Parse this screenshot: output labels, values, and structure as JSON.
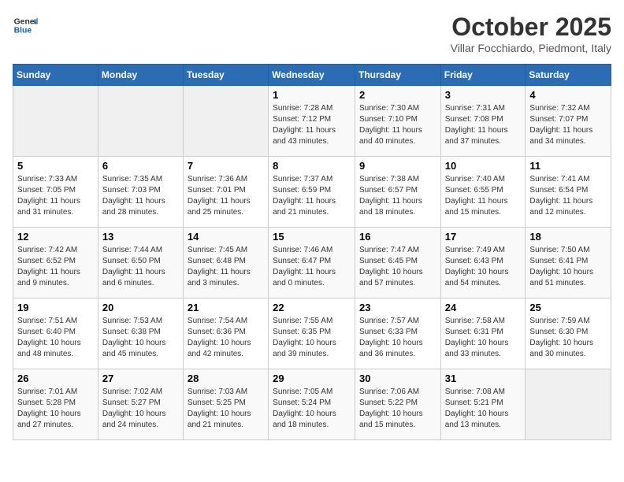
{
  "header": {
    "logo_line1": "General",
    "logo_line2": "Blue",
    "month": "October 2025",
    "location": "Villar Focchiardo, Piedmont, Italy"
  },
  "days_of_week": [
    "Sunday",
    "Monday",
    "Tuesday",
    "Wednesday",
    "Thursday",
    "Friday",
    "Saturday"
  ],
  "weeks": [
    [
      {
        "day": "",
        "content": ""
      },
      {
        "day": "",
        "content": ""
      },
      {
        "day": "",
        "content": ""
      },
      {
        "day": "1",
        "content": "Sunrise: 7:28 AM\nSunset: 7:12 PM\nDaylight: 11 hours and 43 minutes."
      },
      {
        "day": "2",
        "content": "Sunrise: 7:30 AM\nSunset: 7:10 PM\nDaylight: 11 hours and 40 minutes."
      },
      {
        "day": "3",
        "content": "Sunrise: 7:31 AM\nSunset: 7:08 PM\nDaylight: 11 hours and 37 minutes."
      },
      {
        "day": "4",
        "content": "Sunrise: 7:32 AM\nSunset: 7:07 PM\nDaylight: 11 hours and 34 minutes."
      }
    ],
    [
      {
        "day": "5",
        "content": "Sunrise: 7:33 AM\nSunset: 7:05 PM\nDaylight: 11 hours and 31 minutes."
      },
      {
        "day": "6",
        "content": "Sunrise: 7:35 AM\nSunset: 7:03 PM\nDaylight: 11 hours and 28 minutes."
      },
      {
        "day": "7",
        "content": "Sunrise: 7:36 AM\nSunset: 7:01 PM\nDaylight: 11 hours and 25 minutes."
      },
      {
        "day": "8",
        "content": "Sunrise: 7:37 AM\nSunset: 6:59 PM\nDaylight: 11 hours and 21 minutes."
      },
      {
        "day": "9",
        "content": "Sunrise: 7:38 AM\nSunset: 6:57 PM\nDaylight: 11 hours and 18 minutes."
      },
      {
        "day": "10",
        "content": "Sunrise: 7:40 AM\nSunset: 6:55 PM\nDaylight: 11 hours and 15 minutes."
      },
      {
        "day": "11",
        "content": "Sunrise: 7:41 AM\nSunset: 6:54 PM\nDaylight: 11 hours and 12 minutes."
      }
    ],
    [
      {
        "day": "12",
        "content": "Sunrise: 7:42 AM\nSunset: 6:52 PM\nDaylight: 11 hours and 9 minutes."
      },
      {
        "day": "13",
        "content": "Sunrise: 7:44 AM\nSunset: 6:50 PM\nDaylight: 11 hours and 6 minutes."
      },
      {
        "day": "14",
        "content": "Sunrise: 7:45 AM\nSunset: 6:48 PM\nDaylight: 11 hours and 3 minutes."
      },
      {
        "day": "15",
        "content": "Sunrise: 7:46 AM\nSunset: 6:47 PM\nDaylight: 11 hours and 0 minutes."
      },
      {
        "day": "16",
        "content": "Sunrise: 7:47 AM\nSunset: 6:45 PM\nDaylight: 10 hours and 57 minutes."
      },
      {
        "day": "17",
        "content": "Sunrise: 7:49 AM\nSunset: 6:43 PM\nDaylight: 10 hours and 54 minutes."
      },
      {
        "day": "18",
        "content": "Sunrise: 7:50 AM\nSunset: 6:41 PM\nDaylight: 10 hours and 51 minutes."
      }
    ],
    [
      {
        "day": "19",
        "content": "Sunrise: 7:51 AM\nSunset: 6:40 PM\nDaylight: 10 hours and 48 minutes."
      },
      {
        "day": "20",
        "content": "Sunrise: 7:53 AM\nSunset: 6:38 PM\nDaylight: 10 hours and 45 minutes."
      },
      {
        "day": "21",
        "content": "Sunrise: 7:54 AM\nSunset: 6:36 PM\nDaylight: 10 hours and 42 minutes."
      },
      {
        "day": "22",
        "content": "Sunrise: 7:55 AM\nSunset: 6:35 PM\nDaylight: 10 hours and 39 minutes."
      },
      {
        "day": "23",
        "content": "Sunrise: 7:57 AM\nSunset: 6:33 PM\nDaylight: 10 hours and 36 minutes."
      },
      {
        "day": "24",
        "content": "Sunrise: 7:58 AM\nSunset: 6:31 PM\nDaylight: 10 hours and 33 minutes."
      },
      {
        "day": "25",
        "content": "Sunrise: 7:59 AM\nSunset: 6:30 PM\nDaylight: 10 hours and 30 minutes."
      }
    ],
    [
      {
        "day": "26",
        "content": "Sunrise: 7:01 AM\nSunset: 5:28 PM\nDaylight: 10 hours and 27 minutes."
      },
      {
        "day": "27",
        "content": "Sunrise: 7:02 AM\nSunset: 5:27 PM\nDaylight: 10 hours and 24 minutes."
      },
      {
        "day": "28",
        "content": "Sunrise: 7:03 AM\nSunset: 5:25 PM\nDaylight: 10 hours and 21 minutes."
      },
      {
        "day": "29",
        "content": "Sunrise: 7:05 AM\nSunset: 5:24 PM\nDaylight: 10 hours and 18 minutes."
      },
      {
        "day": "30",
        "content": "Sunrise: 7:06 AM\nSunset: 5:22 PM\nDaylight: 10 hours and 15 minutes."
      },
      {
        "day": "31",
        "content": "Sunrise: 7:08 AM\nSunset: 5:21 PM\nDaylight: 10 hours and 13 minutes."
      },
      {
        "day": "",
        "content": ""
      }
    ]
  ]
}
